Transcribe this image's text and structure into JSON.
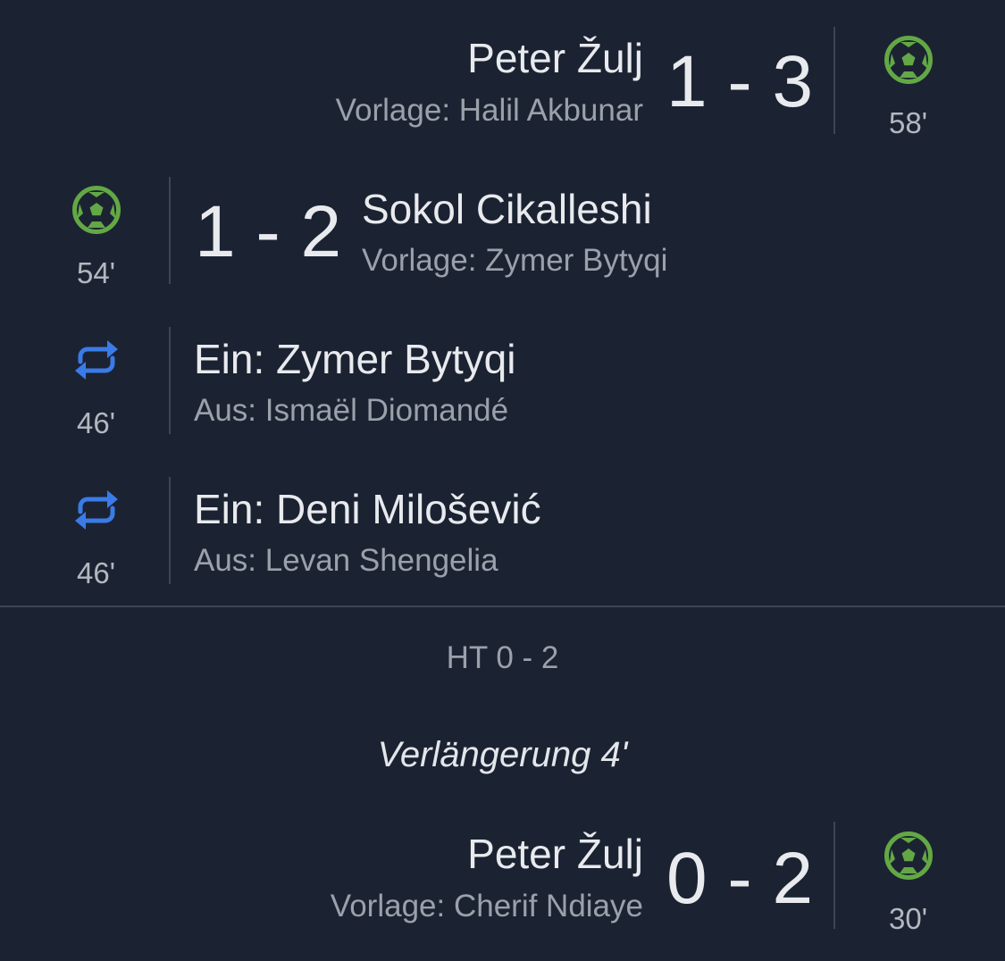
{
  "colors": {
    "background": "#1b2332",
    "goal_icon": "#63a845",
    "substitution_icon": "#3a7be8",
    "divider": "#3d4656"
  },
  "events": [
    {
      "type": "goal",
      "side": "away",
      "icon": "soccer-ball-icon",
      "player": "Peter Žulj",
      "assist": "Vorlage: Halil Akbunar",
      "score": "1 - 3",
      "minute": "58'"
    },
    {
      "type": "goal",
      "side": "home",
      "icon": "soccer-ball-icon",
      "player": "Sokol Cikalleshi",
      "assist": "Vorlage: Zymer Bytyqi",
      "score": "1 - 2",
      "minute": "54'"
    },
    {
      "type": "substitution",
      "side": "home",
      "icon": "substitution-icon",
      "player_in": "Ein: Zymer Bytyqi",
      "player_out": "Aus: Ismaël Diomandé",
      "minute": "46'"
    },
    {
      "type": "substitution",
      "side": "home",
      "icon": "substitution-icon",
      "player_in": "Ein: Deni Milošević",
      "player_out": "Aus: Levan Shengelia",
      "minute": "46'"
    }
  ],
  "halftime": "HT 0 - 2",
  "stoppage_time": "Verlängerung 4'",
  "first_half_events": [
    {
      "type": "goal",
      "side": "away",
      "icon": "soccer-ball-icon",
      "player": "Peter Žulj",
      "assist": "Vorlage: Cherif Ndiaye",
      "score": "0 - 2",
      "minute": "30'"
    }
  ]
}
